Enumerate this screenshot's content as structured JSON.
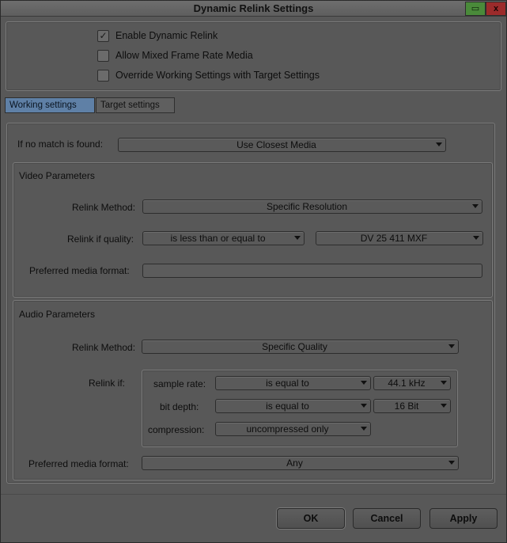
{
  "window": {
    "title": "Dynamic Relink Settings",
    "minimize_glyph": "▭",
    "close_glyph": "x"
  },
  "options": {
    "enable_dynamic_relink": {
      "label": "Enable Dynamic Relink",
      "checked": true
    },
    "allow_mixed_frame_rate": {
      "label": "Allow Mixed Frame Rate Media",
      "checked": false
    },
    "override_working": {
      "label": "Override Working Settings with Target Settings",
      "checked": false
    }
  },
  "tabs": [
    {
      "label": "Working settings",
      "active": true
    },
    {
      "label": "Target settings",
      "active": false
    }
  ],
  "no_match": {
    "label": "If no match is found:",
    "value": "Use Closest Media"
  },
  "video": {
    "heading": "Video Parameters",
    "relink_method_label": "Relink Method:",
    "relink_method_value": "Specific Resolution",
    "relink_quality_label": "Relink if quality:",
    "relink_quality_op": "is less than or equal to",
    "relink_quality_value": "DV 25 411  MXF",
    "preferred_format_label": "Preferred media format:",
    "preferred_format_value": ""
  },
  "audio": {
    "heading": "Audio Parameters",
    "relink_method_label": "Relink Method:",
    "relink_method_value": "Specific Quality",
    "relink_if_label": "Relink if:",
    "sample_rate_label": "sample rate:",
    "sample_rate_op": "is equal to",
    "sample_rate_value": "44.1 kHz",
    "bit_depth_label": "bit depth:",
    "bit_depth_op": "is equal to",
    "bit_depth_value": "16 Bit",
    "compression_label": "compression:",
    "compression_value": "uncompressed only",
    "preferred_format_label": "Preferred media format:",
    "preferred_format_value": "Any"
  },
  "buttons": {
    "ok": "OK",
    "cancel": "Cancel",
    "apply": "Apply"
  },
  "icons": {
    "checkmark": "✓"
  }
}
